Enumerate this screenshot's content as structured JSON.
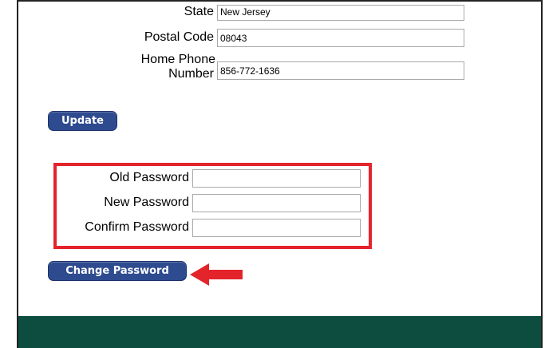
{
  "contact_fields": [
    {
      "label": "State",
      "value": "New Jersey"
    },
    {
      "label": "Postal Code",
      "value": "08043"
    },
    {
      "label_line1": "Home Phone",
      "label_line2": "Number",
      "value": "856-772-1636"
    }
  ],
  "update_button": "Update",
  "password": {
    "old_label": "Old Password",
    "new_label": "New Password",
    "confirm_label": "Confirm Password",
    "old_value": "",
    "new_value": "",
    "confirm_value": ""
  },
  "change_password_button": "Change Password",
  "colors": {
    "button": "#2e4b8f",
    "highlight": "#e3242b",
    "footer": "#0c4d3f"
  },
  "icons": {
    "annotation_arrow": "red-left-arrow-icon"
  }
}
